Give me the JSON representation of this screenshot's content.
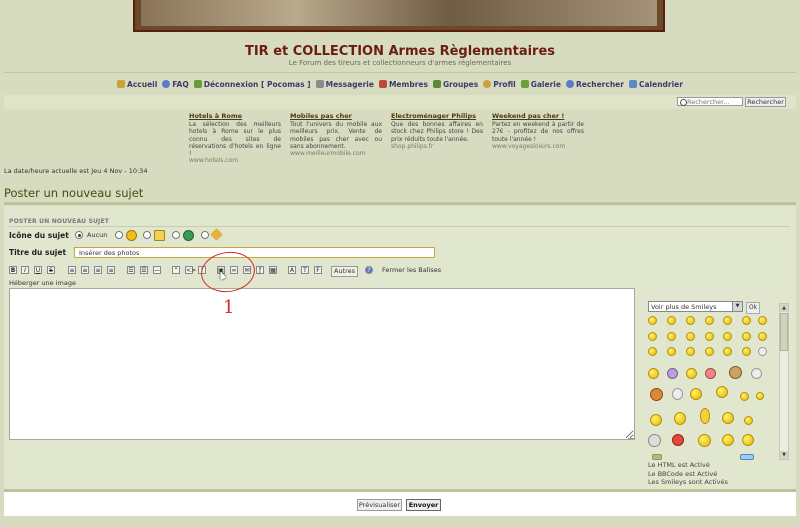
{
  "header": {
    "title": "TIR et COLLECTION Armes Règlementaires",
    "subtitle": "Le Forum des tireurs et collectionneurs d'armes réglementaires"
  },
  "nav": [
    {
      "label": "Accueil",
      "icon": "home-icon",
      "color": "#c9a23b"
    },
    {
      "label": "FAQ",
      "icon": "faq-icon",
      "color": "#5b7bc9"
    },
    {
      "label": "Déconnexion [ Pocomas ]",
      "icon": "logout-icon",
      "color": "#6a9a3b"
    },
    {
      "label": "Messagerie",
      "icon": "mail-icon",
      "color": "#8a8a8a"
    },
    {
      "label": "Membres",
      "icon": "members-icon",
      "color": "#c04a3a"
    },
    {
      "label": "Groupes",
      "icon": "groups-icon",
      "color": "#5c8a3a"
    },
    {
      "label": "Profil",
      "icon": "profile-icon",
      "color": "#c9a23b"
    },
    {
      "label": "Galerie",
      "icon": "gallery-icon",
      "color": "#6aa03b"
    },
    {
      "label": "Rechercher",
      "icon": "search-icon",
      "color": "#5b7bc9"
    },
    {
      "label": "Calendrier",
      "icon": "calendar-icon",
      "color": "#5b8ac9"
    }
  ],
  "search": {
    "placeholder": "Rechercher...",
    "button": "Rechercher"
  },
  "ads": [
    {
      "title": "Hotels à Rome",
      "text": "La sélection des meilleurs hotels à Rome sur le plus connu des sites de réservations d'hotels en ligne !",
      "url": "www.hotels.com"
    },
    {
      "title": "Mobiles pas cher",
      "text": "Tout l'univers du mobile aux meilleurs prix. Vente de mobiles pas cher avec ou sans abonnement.",
      "url": "www.meilleurmobile.com"
    },
    {
      "title": "Electroménager Philips",
      "text": "Que des bonnes affaires en stock chez Philips store ! Des prix réduits toute l'année.",
      "url": "shop.philips.fr"
    },
    {
      "title": "Weekend pas cher !",
      "text": "Partez en weekend à partir de 27€ - profitez de nos offres toute l'année !",
      "url": "www.voyagesloisirs.com"
    }
  ],
  "datetime": "La date/heure actuelle est Jeu 4 Nov - 10:34",
  "page_title": "Poster un nouveau sujet",
  "form": {
    "section_title": "POSTER UN NOUVEAU SUJET",
    "icon_label": "Icône du sujet",
    "icon_none": "Aucun",
    "subject_label": "Titre du sujet",
    "subject_value": "Insérer des photos",
    "toolbar_autres": "Autres",
    "toolbar_close_tags": "Fermer les Balises",
    "host_image": "Héberger une image",
    "smiley_select": "Voir plus de Smileys",
    "smiley_ok": "Ok",
    "rules": [
      "Le HTML est Activé",
      "Le BBCode est Activé",
      "Les Smileys sont Activés"
    ],
    "preview_button": "Prévisualiser",
    "submit_button": "Envoyer"
  },
  "annotation": {
    "number": "1",
    "color": "#d42a2a"
  }
}
